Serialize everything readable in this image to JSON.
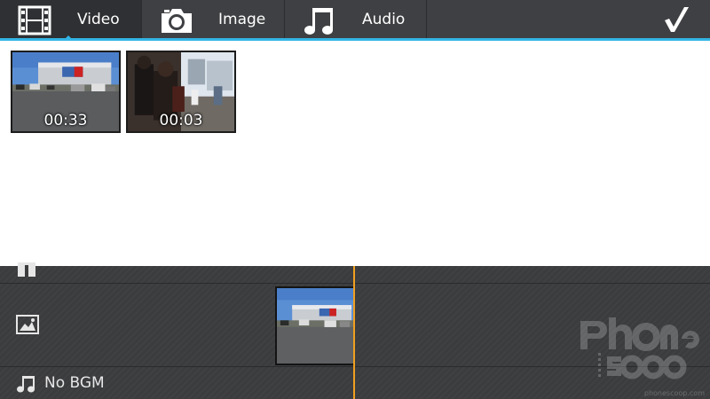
{
  "tabs": [
    {
      "label": "Video",
      "icon": "film-icon",
      "active": true
    },
    {
      "label": "Image",
      "icon": "camera-icon",
      "active": false
    },
    {
      "label": "Audio",
      "icon": "music-note-icon",
      "active": false
    }
  ],
  "toolbar": {
    "done_icon": "checkmark-icon"
  },
  "accent_color": "#33b5e5",
  "playhead_color": "#f0a020",
  "media_items": [
    {
      "duration": "00:33"
    },
    {
      "duration": "00:03"
    }
  ],
  "timeline": {
    "bgm_label": "No BGM"
  },
  "watermark": {
    "text": "phonescoop"
  },
  "credit": "phonescoop.com"
}
